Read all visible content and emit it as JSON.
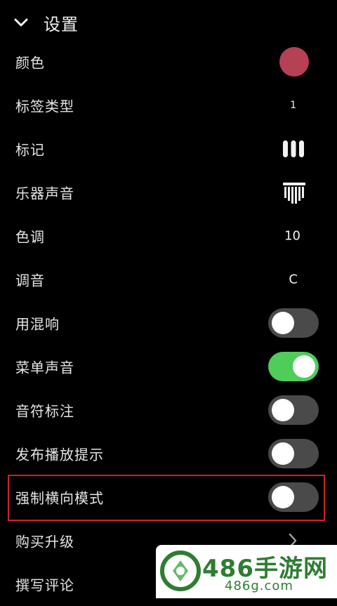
{
  "header": {
    "title": "设置"
  },
  "colors": {
    "swatch": "#b64054",
    "toggle_on": "#4fcd59",
    "toggle_off": "#4a4a4a",
    "highlight": "#d0202a",
    "watermark_green": "#2e7d32"
  },
  "rows": [
    {
      "label": "颜色",
      "kind": "color"
    },
    {
      "label": "标签类型",
      "kind": "text",
      "value": "1"
    },
    {
      "label": "标记",
      "kind": "icon",
      "icon": "bars-icon"
    },
    {
      "label": "乐器声音",
      "kind": "icon",
      "icon": "kalimba-icon"
    },
    {
      "label": "色调",
      "kind": "text",
      "value": "10"
    },
    {
      "label": "调音",
      "kind": "text",
      "value": "C"
    },
    {
      "label": "用混响",
      "kind": "toggle",
      "on": false
    },
    {
      "label": "菜单声音",
      "kind": "toggle",
      "on": true
    },
    {
      "label": "音符标注",
      "kind": "toggle",
      "on": false
    },
    {
      "label": "发布播放提示",
      "kind": "toggle",
      "on": false
    },
    {
      "label": "强制横向模式",
      "kind": "toggle",
      "on": false
    },
    {
      "label": "购买升级",
      "kind": "chevron"
    },
    {
      "label": "撰写评论",
      "kind": "none"
    }
  ],
  "watermark": {
    "brand": "486手游网",
    "domain": "486g.com"
  }
}
